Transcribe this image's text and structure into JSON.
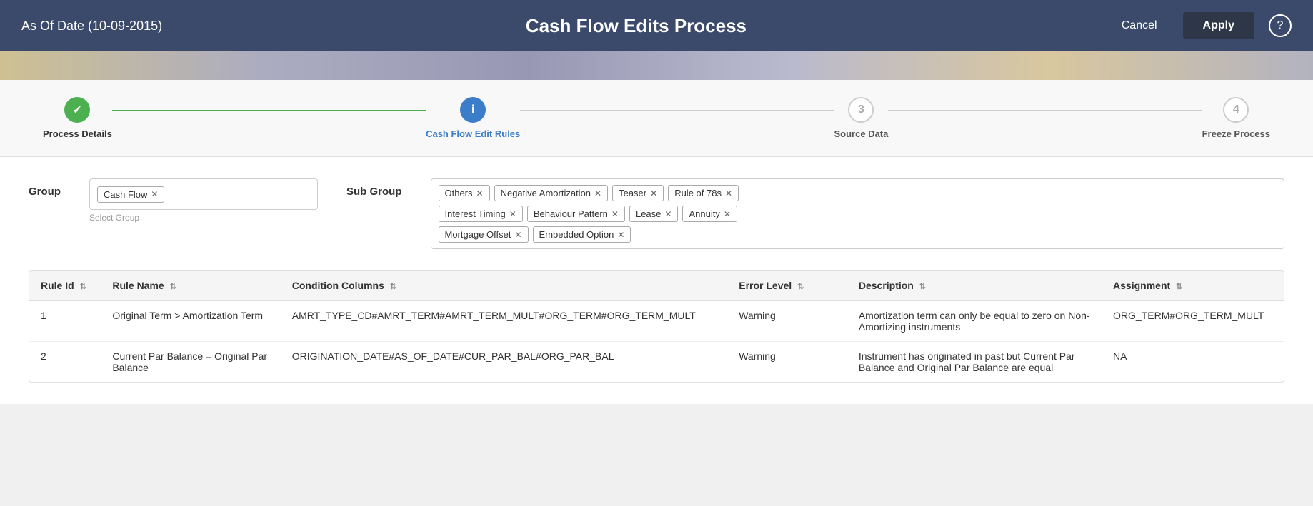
{
  "header": {
    "as_of_date": "As Of Date (10-09-2015)",
    "title": "Cash Flow Edits Process",
    "cancel_label": "Cancel",
    "apply_label": "Apply",
    "help_icon": "?"
  },
  "stepper": {
    "steps": [
      {
        "id": 1,
        "label": "Process Details",
        "state": "done",
        "icon": "✓"
      },
      {
        "id": 2,
        "label": "Cash Flow Edit Rules",
        "state": "active",
        "icon": "i"
      },
      {
        "id": 3,
        "label": "Source Data",
        "state": "inactive",
        "icon": "3"
      },
      {
        "id": 4,
        "label": "Freeze Process",
        "state": "inactive",
        "icon": "4"
      }
    ]
  },
  "filters": {
    "group_label": "Group",
    "group_tags": [
      {
        "text": "Cash Flow",
        "id": "cash-flow"
      }
    ],
    "group_hint": "Select Group",
    "sub_group_label": "Sub Group",
    "sub_group_tags_row1": [
      {
        "text": "Others"
      },
      {
        "text": "Negative Amortization"
      },
      {
        "text": "Teaser"
      },
      {
        "text": "Rule of 78s"
      }
    ],
    "sub_group_tags_row2": [
      {
        "text": "Interest Timing"
      },
      {
        "text": "Behaviour Pattern"
      },
      {
        "text": "Lease"
      },
      {
        "text": "Annuity"
      }
    ],
    "sub_group_tags_row3": [
      {
        "text": "Mortgage Offset"
      },
      {
        "text": "Embedded Option"
      }
    ]
  },
  "table": {
    "columns": [
      {
        "key": "rule_id",
        "label": "Rule Id"
      },
      {
        "key": "rule_name",
        "label": "Rule Name"
      },
      {
        "key": "condition_columns",
        "label": "Condition Columns"
      },
      {
        "key": "error_level",
        "label": "Error Level"
      },
      {
        "key": "description",
        "label": "Description"
      },
      {
        "key": "assignment",
        "label": "Assignment"
      }
    ],
    "rows": [
      {
        "rule_id": "1",
        "rule_name": "Original Term > Amortization Term",
        "condition_columns": "AMRT_TYPE_CD#AMRT_TERM#AMRT_TERM_MULT#ORG_TERM#ORG_TERM_MULT",
        "error_level": "Warning",
        "description": "Amortization term can only be equal to zero on Non-Amortizing instruments",
        "assignment": "ORG_TERM#ORG_TERM_MULT"
      },
      {
        "rule_id": "2",
        "rule_name": "Current Par Balance = Original Par Balance",
        "condition_columns": "ORIGINATION_DATE#AS_OF_DATE#CUR_PAR_BAL#ORG_PAR_BAL",
        "error_level": "Warning",
        "description": "Instrument has originated in past but Current Par Balance and Original Par Balance are equal",
        "assignment": "NA"
      }
    ]
  }
}
